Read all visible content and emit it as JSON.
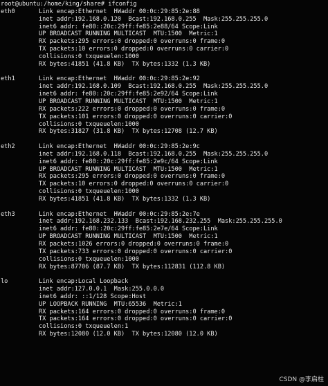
{
  "terminal": {
    "prompt": "root@ubuntu:/home/king/share# ifconfig",
    "interfaces": [
      {
        "name": "eth0",
        "lines": [
          "Link encap:Ethernet  HWaddr 00:0c:29:85:2e:88",
          "inet addr:192.168.0.120  Bcast:192.168.0.255  Mask:255.255.255.0",
          "inet6 addr: fe80::20c:29ff:fe85:2e88/64 Scope:Link",
          "UP BROADCAST RUNNING MULTICAST  MTU:1500  Metric:1",
          "RX packets:295 errors:0 dropped:0 overruns:0 frame:0",
          "TX packets:10 errors:0 dropped:0 overruns:0 carrier:0",
          "collisions:0 txqueuelen:1000",
          "RX bytes:41851 (41.8 KB)  TX bytes:1332 (1.3 KB)"
        ]
      },
      {
        "name": "eth1",
        "lines": [
          "Link encap:Ethernet  HWaddr 00:0c:29:85:2e:92",
          "inet addr:192.168.0.109  Bcast:192.168.0.255  Mask:255.255.255.0",
          "inet6 addr: fe80::20c:29ff:fe85:2e92/64 Scope:Link",
          "UP BROADCAST RUNNING MULTICAST  MTU:1500  Metric:1",
          "RX packets:222 errors:0 dropped:0 overruns:0 frame:0",
          "TX packets:101 errors:0 dropped:0 overruns:0 carrier:0",
          "collisions:0 txqueuelen:1000",
          "RX bytes:31827 (31.8 KB)  TX bytes:12708 (12.7 KB)"
        ]
      },
      {
        "name": "eth2",
        "lines": [
          "Link encap:Ethernet  HWaddr 00:0c:29:85:2e:9c",
          "inet addr:192.168.0.118  Bcast:192.168.0.255  Mask:255.255.255.0",
          "inet6 addr: fe80::20c:29ff:fe85:2e9c/64 Scope:Link",
          "UP BROADCAST RUNNING MULTICAST  MTU:1500  Metric:1",
          "RX packets:295 errors:0 dropped:0 overruns:0 frame:0",
          "TX packets:10 errors:0 dropped:0 overruns:0 carrier:0",
          "collisions:0 txqueuelen:1000",
          "RX bytes:41851 (41.8 KB)  TX bytes:1332 (1.3 KB)"
        ]
      },
      {
        "name": "eth3",
        "lines": [
          "Link encap:Ethernet  HWaddr 00:0c:29:85:2e:7e",
          "inet addr:192.168.232.133  Bcast:192.168.232.255  Mask:255.255.255.0",
          "inet6 addr: fe80::20c:29ff:fe85:2e7e/64 Scope:Link",
          "UP BROADCAST RUNNING MULTICAST  MTU:1500  Metric:1",
          "RX packets:1026 errors:0 dropped:0 overruns:0 frame:0",
          "TX packets:733 errors:0 dropped:0 overruns:0 carrier:0",
          "collisions:0 txqueuelen:1000",
          "RX bytes:87706 (87.7 KB)  TX bytes:112831 (112.8 KB)"
        ]
      },
      {
        "name": "lo",
        "lines": [
          "Link encap:Local Loopback",
          "inet addr:127.0.0.1  Mask:255.0.0.0",
          "inet6 addr: ::1/128 Scope:Host",
          "UP LOOPBACK RUNNING  MTU:65536  Metric:1",
          "RX packets:164 errors:0 dropped:0 overruns:0 frame:0",
          "TX packets:164 errors:0 dropped:0 overruns:0 carrier:0",
          "collisions:0 txqueuelen:1",
          "RX bytes:12080 (12.0 KB)  TX bytes:12080 (12.0 KB)"
        ]
      }
    ]
  },
  "watermark": "CSDN @李启柱",
  "colors": {
    "background": "#050505",
    "text": "#e8e8e8"
  }
}
